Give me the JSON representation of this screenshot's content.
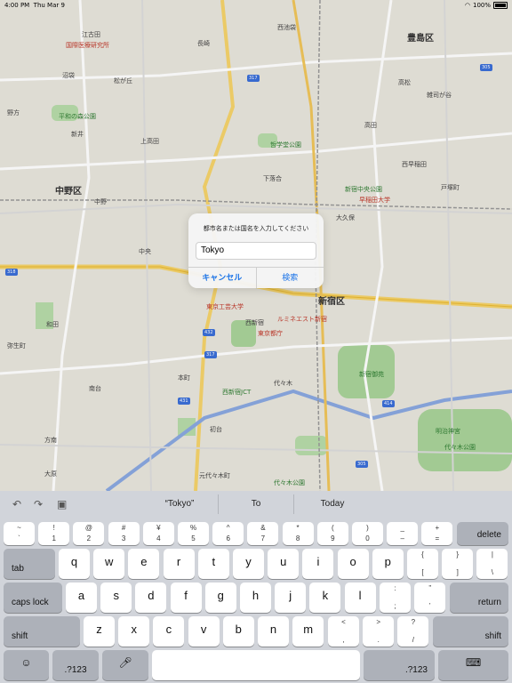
{
  "status_bar": {
    "time": "4:00 PM",
    "date": "Thu Mar 9",
    "battery": "100%"
  },
  "map": {
    "labels": [
      {
        "text": "中野区",
        "cls": "big"
      },
      {
        "text": "新宿区",
        "cls": "big"
      },
      {
        "text": "豊島区",
        "cls": "big"
      },
      {
        "text": "江古田",
        "cls": ""
      },
      {
        "text": "沼袋",
        "cls": ""
      },
      {
        "text": "松が丘",
        "cls": ""
      },
      {
        "text": "野方",
        "cls": ""
      },
      {
        "text": "新井",
        "cls": ""
      },
      {
        "text": "上高田",
        "cls": ""
      },
      {
        "text": "中野",
        "cls": ""
      },
      {
        "text": "中央",
        "cls": ""
      },
      {
        "text": "和田",
        "cls": ""
      },
      {
        "text": "弥生町",
        "cls": ""
      },
      {
        "text": "南台",
        "cls": ""
      },
      {
        "text": "本町",
        "cls": ""
      },
      {
        "text": "方南",
        "cls": ""
      },
      {
        "text": "大原",
        "cls": ""
      },
      {
        "text": "元代々木町",
        "cls": ""
      },
      {
        "text": "初台",
        "cls": ""
      },
      {
        "text": "代々木",
        "cls": ""
      },
      {
        "text": "西新宿",
        "cls": ""
      },
      {
        "text": "大久保",
        "cls": ""
      },
      {
        "text": "高田",
        "cls": ""
      },
      {
        "text": "西早稲田",
        "cls": ""
      },
      {
        "text": "戸塚町",
        "cls": ""
      },
      {
        "text": "下落合",
        "cls": ""
      },
      {
        "text": "西池袋",
        "cls": ""
      },
      {
        "text": "高松",
        "cls": ""
      },
      {
        "text": "雑司が谷",
        "cls": ""
      },
      {
        "text": "長崎",
        "cls": ""
      },
      {
        "text": "東京都庁",
        "cls": "red"
      },
      {
        "text": "新宿御苑",
        "cls": "green"
      },
      {
        "text": "明治神宮",
        "cls": "green"
      },
      {
        "text": "代々木公園",
        "cls": "green"
      },
      {
        "text": "平和の森公園",
        "cls": "green"
      },
      {
        "text": "哲学堂公園",
        "cls": "green"
      },
      {
        "text": "新宿中央公園",
        "cls": "green"
      },
      {
        "text": "早稲田大学",
        "cls": "red"
      },
      {
        "text": "東京工芸大学",
        "cls": "red"
      },
      {
        "text": "国際医療研究所",
        "cls": "red"
      },
      {
        "text": "ルミネエスト新宿",
        "cls": "red"
      },
      {
        "text": "代々木公園",
        "cls": "green"
      },
      {
        "text": "西新宿JCT",
        "cls": "green"
      }
    ]
  },
  "dialog": {
    "message": "都市名または国名を入力してください",
    "input_value": "Tokyo",
    "cancel_label": "キャンセル",
    "search_label": "検索"
  },
  "keyboard": {
    "suggestions": [
      "“Tokyo”",
      "To",
      "Today"
    ],
    "tool_icons": [
      "undo-icon",
      "redo-icon",
      "paste-icon"
    ],
    "row1": [
      {
        "top": "~",
        "bot": "`"
      },
      {
        "top": "!",
        "bot": "1"
      },
      {
        "top": "@",
        "bot": "2"
      },
      {
        "top": "#",
        "bot": "3"
      },
      {
        "top": "¥",
        "bot": "4"
      },
      {
        "top": "%",
        "bot": "5"
      },
      {
        "top": "^",
        "bot": "6"
      },
      {
        "top": "&",
        "bot": "7"
      },
      {
        "top": "*",
        "bot": "8"
      },
      {
        "top": "(",
        "bot": "9"
      },
      {
        "top": ")",
        "bot": "0"
      },
      {
        "top": "_",
        "bot": "–"
      },
      {
        "top": "+",
        "bot": "="
      }
    ],
    "delete_label": "delete",
    "tab_label": "tab",
    "row2": [
      "q",
      "w",
      "e",
      "r",
      "t",
      "y",
      "u",
      "i",
      "o",
      "p"
    ],
    "row2_extra": [
      {
        "top": "{",
        "bot": "["
      },
      {
        "top": "}",
        "bot": "]"
      },
      {
        "top": "|",
        "bot": "\\"
      }
    ],
    "caps_label": "caps lock",
    "row3": [
      "a",
      "s",
      "d",
      "f",
      "g",
      "h",
      "j",
      "k",
      "l"
    ],
    "row3_extra": [
      {
        "top": ":",
        "bot": ";"
      },
      {
        "top": "”",
        "bot": "’"
      }
    ],
    "return_label": "return",
    "shift_label": "shift",
    "row4": [
      "z",
      "x",
      "c",
      "v",
      "b",
      "n",
      "m"
    ],
    "row4_extra": [
      {
        "top": "<",
        "bot": ","
      },
      {
        "top": ">",
        "bot": "."
      },
      {
        "top": "?",
        "bot": "/"
      }
    ],
    "numbers_label": ".?123"
  }
}
